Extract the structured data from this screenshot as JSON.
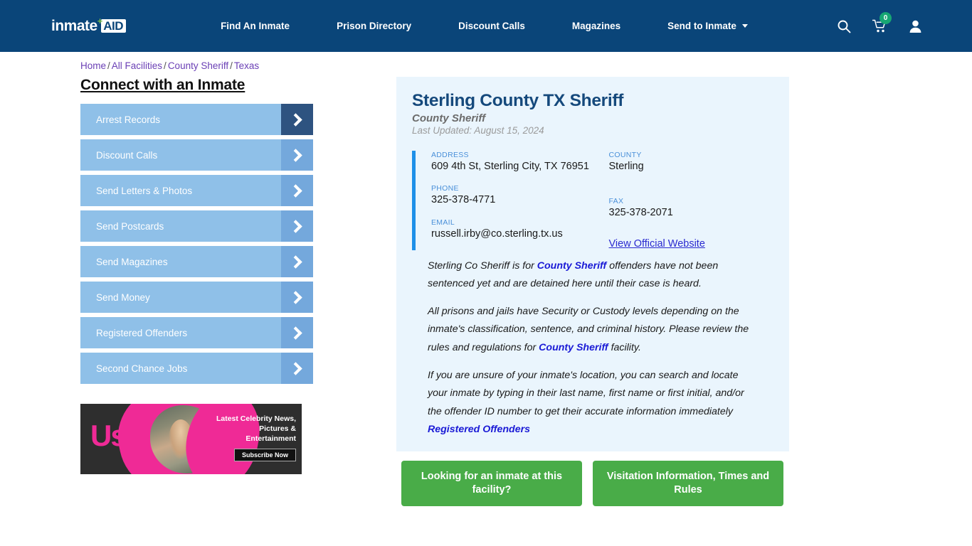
{
  "header": {
    "logo": {
      "text": "inmate",
      "badge": "AID",
      "plus": "+"
    },
    "nav": [
      {
        "label": "Find An Inmate",
        "dropdown": false
      },
      {
        "label": "Prison Directory",
        "dropdown": false
      },
      {
        "label": "Discount Calls",
        "dropdown": false
      },
      {
        "label": "Magazines",
        "dropdown": false
      },
      {
        "label": "Send to Inmate",
        "dropdown": true
      }
    ],
    "icons": {
      "search": "search-icon",
      "cart": "shopping-cart-icon",
      "cart_count": "0",
      "account": "user-account-icon"
    },
    "bg_color": "#0a4579",
    "badge_color": "#17a673"
  },
  "breadcrumb": {
    "items": [
      {
        "label": "Home"
      },
      {
        "label": "All Facilities"
      },
      {
        "label": "County Sheriff"
      },
      {
        "label": "Texas"
      }
    ],
    "separator": "/"
  },
  "sidebar": {
    "title": "Connect with an Inmate",
    "items": [
      {
        "label": "Arrest Records",
        "active": true
      },
      {
        "label": "Discount Calls",
        "active": false
      },
      {
        "label": "Send Letters & Photos",
        "active": false
      },
      {
        "label": "Send Postcards",
        "active": false
      },
      {
        "label": "Send Magazines",
        "active": false
      },
      {
        "label": "Send Money",
        "active": false
      },
      {
        "label": "Registered Offenders",
        "active": false
      },
      {
        "label": "Second Chance Jobs",
        "active": false
      }
    ],
    "ad": {
      "brand": "Us",
      "copy": "Latest Celebrity News, Pictures & Entertainment",
      "cta": "Subscribe Now",
      "accent_color": "#ef2a96"
    }
  },
  "facility": {
    "name": "Sterling County TX Sheriff",
    "type": "County Sheriff",
    "updated": "Last Updated: August 15, 2024",
    "fields": {
      "address_label": "ADDRESS",
      "address_value": "609 4th St, Sterling City, TX 76951",
      "county_label": "COUNTY",
      "county_value": "Sterling",
      "phone_label": "PHONE",
      "phone_value": "325-378-4771",
      "fax_label": "FAX",
      "fax_value": "325-378-2071",
      "email_label": "EMAIL",
      "email_value": "russell.irby@co.sterling.tx.us",
      "website_link": "View Official Website"
    },
    "accent_bar_color": "#1e90e8",
    "panel_color": "#eaf5fd"
  },
  "description": {
    "p1_a": "Sterling Co Sheriff is for ",
    "p1_link": "County Sheriff",
    "p1_b": " offenders have not been sentenced yet and are detained here until their case is heard.",
    "p2_a": "All prisons and jails have Security or Custody levels depending on the inmate's classification, sentence, and criminal history. Please review the rules and regulations for ",
    "p2_link": "County Sheriff",
    "p2_b": " facility.",
    "p3_a": "If you are unsure of your inmate's location, you can search and locate your inmate by typing in their last name, first name or first initial, and/or the offender ID number to get their accurate information immediately ",
    "p3_link": "Registered Offenders"
  },
  "cta": {
    "primary": "Looking for an inmate at this facility?",
    "secondary": "Visitation Information, Times and Rules",
    "color": "#49ac48"
  }
}
